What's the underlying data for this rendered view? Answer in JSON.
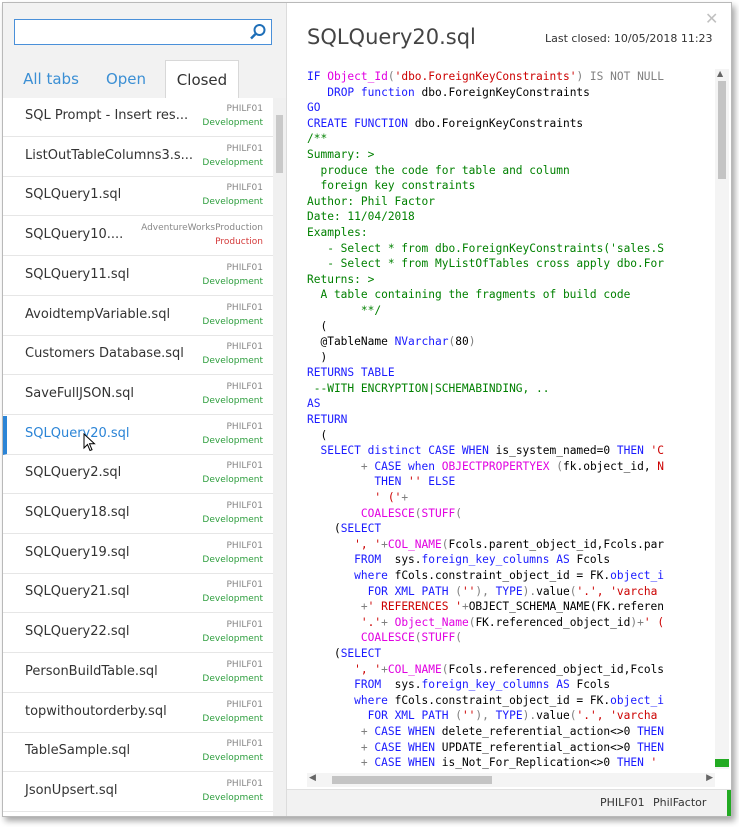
{
  "search": {
    "placeholder": ""
  },
  "tabs": [
    {
      "label": "All tabs"
    },
    {
      "label": "Open"
    },
    {
      "label": "Closed"
    }
  ],
  "rows": [
    {
      "name": "SQL Prompt - Insert res...",
      "server": "PHILF01",
      "env": "Development"
    },
    {
      "name": "ListOutTableColumns3.s...",
      "server": "PHILF01",
      "env": "Development"
    },
    {
      "name": "SQLQuery1.sql",
      "server": "PHILF01",
      "env": "Development"
    },
    {
      "name": "SQLQuery10....",
      "server": "AdventureWorksProduction",
      "env": "Production"
    },
    {
      "name": "SQLQuery11.sql",
      "server": "PHILF01",
      "env": "Development"
    },
    {
      "name": "AvoidtempVariable.sql",
      "server": "PHILF01",
      "env": "Development"
    },
    {
      "name": "Customers Database.sql",
      "server": "PHILF01",
      "env": "Development"
    },
    {
      "name": "SaveFullJSON.sql",
      "server": "PHILF01",
      "env": "Development"
    },
    {
      "name": "SQLQuery20.sql",
      "server": "PHILF01",
      "env": "Development"
    },
    {
      "name": "SQLQuery2.sql",
      "server": "PHILF01",
      "env": "Development"
    },
    {
      "name": "SQLQuery18.sql",
      "server": "PHILF01",
      "env": "Development"
    },
    {
      "name": "SQLQuery19.sql",
      "server": "PHILF01",
      "env": "Development"
    },
    {
      "name": "SQLQuery21.sql",
      "server": "PHILF01",
      "env": "Development"
    },
    {
      "name": "SQLQuery22.sql",
      "server": "PHILF01",
      "env": "Development"
    },
    {
      "name": "PersonBuildTable.sql",
      "server": "PHILF01",
      "env": "Development"
    },
    {
      "name": "topwithoutorderby.sql",
      "server": "PHILF01",
      "env": "Development"
    },
    {
      "name": "TableSample.sql",
      "server": "PHILF01",
      "env": "Development"
    },
    {
      "name": "JsonUpsert.sql",
      "server": "PHILF01",
      "env": "Development"
    }
  ],
  "preview": {
    "title": "SQLQuery20.sql",
    "last_closed": "Last closed: 10/05/2018 11:23"
  },
  "code": [
    [
      [
        "kw",
        "IF "
      ],
      [
        "fn",
        "Object_Id"
      ],
      [
        "gr",
        "("
      ],
      [
        "str",
        "'dbo.ForeignKeyConstraints'"
      ],
      [
        "gr",
        ") IS NOT NULL"
      ]
    ],
    [
      [
        "tx",
        "   "
      ],
      [
        "kw",
        "DROP function "
      ],
      [
        "tx",
        "dbo.ForeignKeyConstraints"
      ]
    ],
    [
      [
        "kw",
        "GO"
      ]
    ],
    [
      [
        "kw",
        "CREATE FUNCTION "
      ],
      [
        "tx",
        "dbo.ForeignKeyConstraints"
      ]
    ],
    [
      [
        "cm",
        "/**"
      ]
    ],
    [
      [
        "cm",
        "Summary: >"
      ]
    ],
    [
      [
        "cm",
        "  produce the code for table and column"
      ]
    ],
    [
      [
        "cm",
        "  foreign key constraints"
      ]
    ],
    [
      [
        "cm",
        "Author: Phil Factor"
      ]
    ],
    [
      [
        "cm",
        "Date: 11/04/2018"
      ]
    ],
    [
      [
        "cm",
        "Examples:"
      ]
    ],
    [
      [
        "cm",
        "   - Select * from dbo.ForeignKeyConstraints('sales.S"
      ]
    ],
    [
      [
        "cm",
        "   - Select * from MyListOfTables cross apply dbo.For"
      ]
    ],
    [
      [
        "cm",
        "Returns: >"
      ]
    ],
    [
      [
        "cm",
        "  A table containing the fragments of build code"
      ]
    ],
    [
      [
        "cm",
        "        **/"
      ]
    ],
    [
      [
        "tx",
        "  ("
      ]
    ],
    [
      [
        "tx",
        "  @TableName "
      ],
      [
        "kw",
        "NVarchar"
      ],
      [
        "gr",
        "("
      ],
      [
        "tx",
        "80"
      ],
      [
        "gr",
        ")"
      ]
    ],
    [
      [
        "tx",
        "  )"
      ]
    ],
    [
      [
        "kw",
        "RETURNS TABLE"
      ]
    ],
    [
      [
        "cm",
        " --WITH ENCRYPTION|SCHEMABINDING, .."
      ]
    ],
    [
      [
        "kw",
        "AS"
      ]
    ],
    [
      [
        "kw",
        "RETURN"
      ]
    ],
    [
      [
        "tx",
        "  ("
      ]
    ],
    [
      [
        "tx",
        "  "
      ],
      [
        "kw",
        "SELECT distinct CASE WHEN "
      ],
      [
        "tx",
        "is_system_named=0 "
      ],
      [
        "kw",
        "THEN "
      ],
      [
        "str",
        "'C"
      ]
    ],
    [
      [
        "tx",
        "        "
      ],
      [
        "gr",
        "+ "
      ],
      [
        "kw",
        "CASE when "
      ],
      [
        "fn",
        "OBJECTPROPERTYEX "
      ],
      [
        "gr",
        "("
      ],
      [
        "tx",
        "fk.object_id, "
      ],
      [
        "str",
        "N"
      ]
    ],
    [
      [
        "tx",
        "          "
      ],
      [
        "kw",
        "THEN "
      ],
      [
        "str",
        "'' "
      ],
      [
        "kw",
        "ELSE"
      ]
    ],
    [
      [
        "tx",
        "          "
      ],
      [
        "str",
        "' ('"
      ],
      [
        "gr",
        "+"
      ]
    ],
    [
      [
        "tx",
        "        "
      ],
      [
        "fn",
        "COALESCE"
      ],
      [
        "gr",
        "("
      ],
      [
        "fn",
        "STUFF"
      ],
      [
        "gr",
        "("
      ]
    ],
    [
      [
        "tx",
        "    ("
      ],
      [
        "kw",
        "SELECT"
      ]
    ],
    [
      [
        "tx",
        "       "
      ],
      [
        "str",
        "', '"
      ],
      [
        "gr",
        "+"
      ],
      [
        "fn",
        "COL_NAME"
      ],
      [
        "gr",
        "("
      ],
      [
        "tx",
        "Fcols.parent_object_id,Fcols.par"
      ]
    ],
    [
      [
        "tx",
        "       "
      ],
      [
        "kw",
        "FROM  "
      ],
      [
        "tx",
        "sys."
      ],
      [
        "kw",
        "foreign_key_columns AS "
      ],
      [
        "tx",
        "Fcols"
      ]
    ],
    [
      [
        "tx",
        "       "
      ],
      [
        "kw",
        "where "
      ],
      [
        "tx",
        "fCols.constraint_object_id = FK."
      ],
      [
        "kw",
        "object_i"
      ]
    ],
    [
      [
        "tx",
        "         "
      ],
      [
        "kw",
        "FOR XML PATH "
      ],
      [
        "gr",
        "("
      ],
      [
        "str",
        "''"
      ],
      [
        "gr",
        "), "
      ],
      [
        "kw",
        "TYPE"
      ],
      [
        "gr",
        ")."
      ],
      [
        "tx",
        "value"
      ],
      [
        "gr",
        "("
      ],
      [
        "str",
        "'.', 'varcha"
      ]
    ],
    [
      [
        "tx",
        "        "
      ],
      [
        "gr",
        "+"
      ],
      [
        "str",
        "' REFERENCES '"
      ],
      [
        "gr",
        "+"
      ],
      [
        "tx",
        "OBJECT_SCHEMA_NAME(FK.referen"
      ]
    ],
    [
      [
        "tx",
        "        "
      ],
      [
        "str",
        "'.'"
      ],
      [
        "gr",
        "+ "
      ],
      [
        "fn",
        "Object_Name"
      ],
      [
        "gr",
        "("
      ],
      [
        "tx",
        "FK.referenced_object_id"
      ],
      [
        "gr",
        ")+"
      ],
      [
        "str",
        "' ("
      ]
    ],
    [
      [
        "tx",
        "        "
      ],
      [
        "fn",
        "COALESCE"
      ],
      [
        "gr",
        "("
      ],
      [
        "fn",
        "STUFF"
      ],
      [
        "gr",
        "("
      ]
    ],
    [
      [
        "tx",
        "    ("
      ],
      [
        "kw",
        "SELECT"
      ]
    ],
    [
      [
        "tx",
        "       "
      ],
      [
        "str",
        "', '"
      ],
      [
        "gr",
        "+"
      ],
      [
        "fn",
        "COL_NAME"
      ],
      [
        "gr",
        "("
      ],
      [
        "tx",
        "Fcols.referenced_object_id,Fcols"
      ]
    ],
    [
      [
        "tx",
        "       "
      ],
      [
        "kw",
        "FROM  "
      ],
      [
        "tx",
        "sys."
      ],
      [
        "kw",
        "foreign_key_columns AS "
      ],
      [
        "tx",
        "Fcols"
      ]
    ],
    [
      [
        "tx",
        "       "
      ],
      [
        "kw",
        "where "
      ],
      [
        "tx",
        "fCols.constraint_object_id = FK."
      ],
      [
        "kw",
        "object_i"
      ]
    ],
    [
      [
        "tx",
        "         "
      ],
      [
        "kw",
        "FOR XML PATH "
      ],
      [
        "gr",
        "("
      ],
      [
        "str",
        "''"
      ],
      [
        "gr",
        "), "
      ],
      [
        "kw",
        "TYPE"
      ],
      [
        "gr",
        ")."
      ],
      [
        "tx",
        "value"
      ],
      [
        "gr",
        "("
      ],
      [
        "str",
        "'.', 'varcha"
      ]
    ],
    [
      [
        "tx",
        "        "
      ],
      [
        "gr",
        "+ "
      ],
      [
        "kw",
        "CASE WHEN "
      ],
      [
        "tx",
        "delete_referential_action<>0 "
      ],
      [
        "kw",
        "THEN"
      ]
    ],
    [
      [
        "tx",
        "        "
      ],
      [
        "gr",
        "+ "
      ],
      [
        "kw",
        "CASE WHEN "
      ],
      [
        "tx",
        "UPDATE_referential_action<>0 "
      ],
      [
        "kw",
        "THEN"
      ]
    ],
    [
      [
        "tx",
        "        "
      ],
      [
        "gr",
        "+ "
      ],
      [
        "kw",
        "CASE WHEN "
      ],
      [
        "tx",
        "is_Not_For_Replication<>0 "
      ],
      [
        "kw",
        "THEN "
      ],
      [
        "str",
        "'"
      ]
    ]
  ],
  "status": {
    "server": "PHILF01",
    "user": "PhilFactor"
  },
  "colors": {
    "accent": "#2b84d6",
    "dev": "#2e9e3e",
    "prod": "#d43b3b"
  }
}
